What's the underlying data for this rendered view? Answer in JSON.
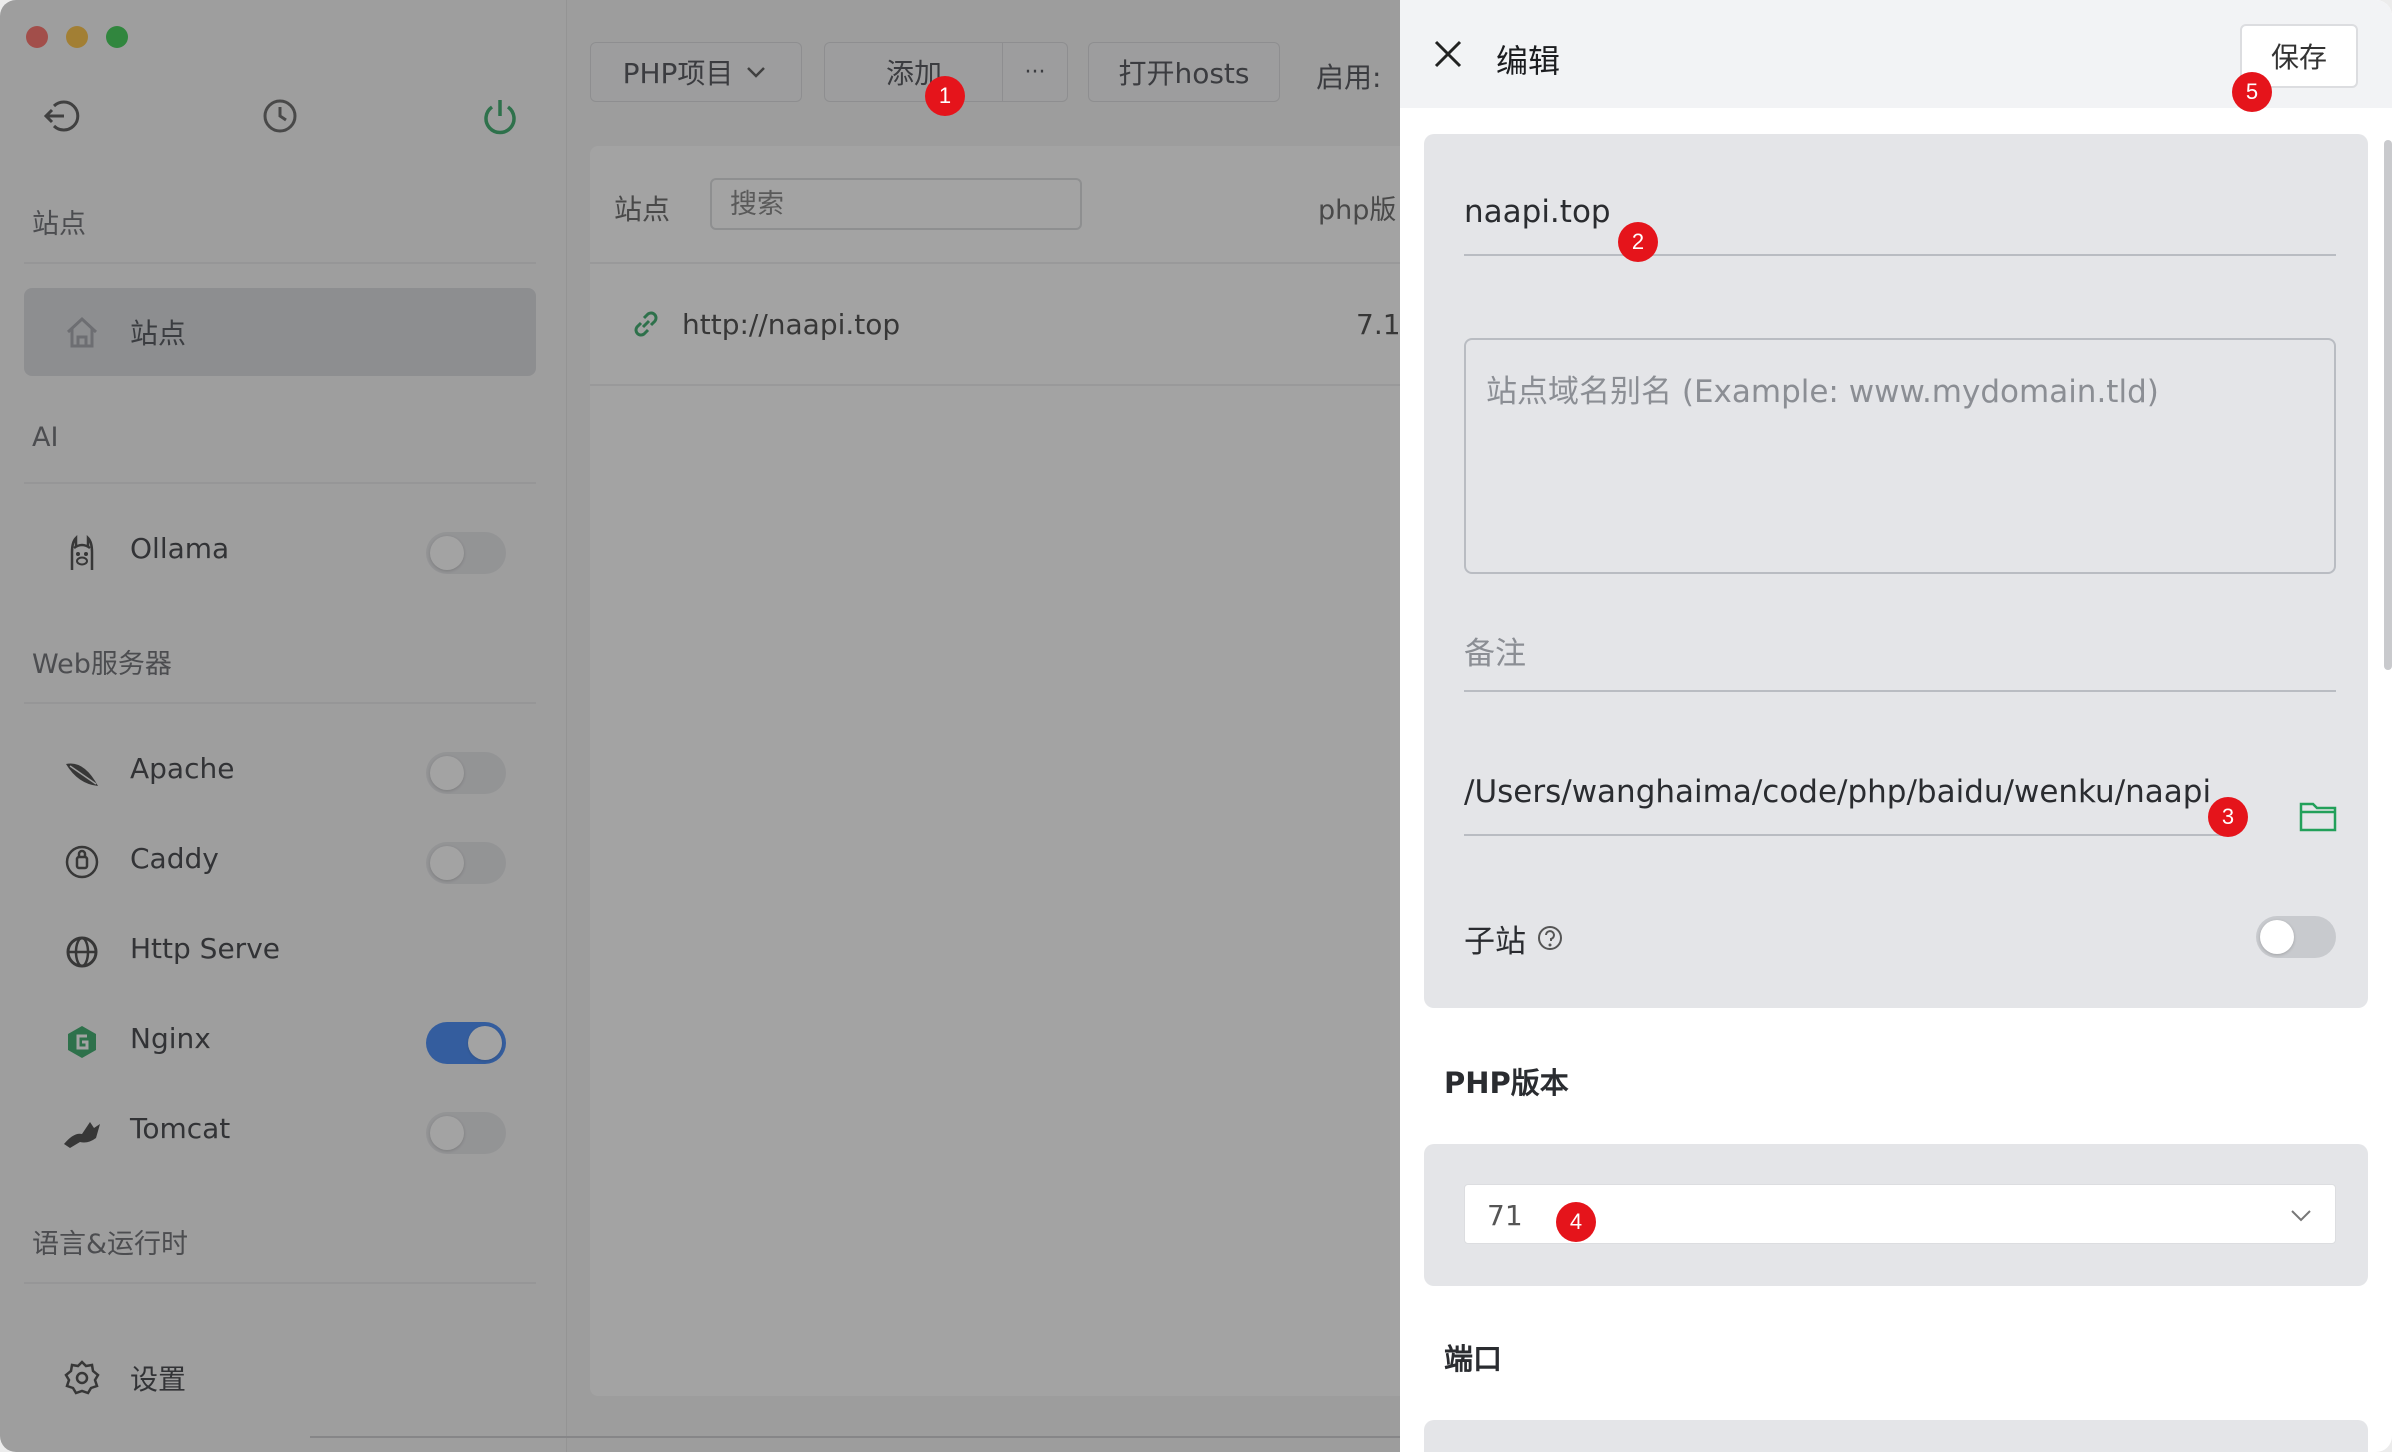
{
  "sidebar": {
    "sections": [
      {
        "label": "站点"
      },
      {
        "label": "AI"
      },
      {
        "label": "Web服务器"
      },
      {
        "label": "语言&运行时"
      }
    ],
    "active_item": {
      "label": "站点",
      "icon": "home-icon"
    },
    "items": [
      {
        "label": "Ollama",
        "icon": "llama-icon",
        "enabled": false
      },
      {
        "label": "Apache",
        "icon": "feather-icon",
        "enabled": false
      },
      {
        "label": "Caddy",
        "icon": "caddy-icon",
        "enabled": false
      },
      {
        "label": "Http Serve",
        "icon": "globe-icon"
      },
      {
        "label": "Nginx",
        "icon": "nginx-icon",
        "enabled": true
      },
      {
        "label": "Tomcat",
        "icon": "tomcat-icon",
        "enabled": false
      }
    ],
    "settings_label": "设置"
  },
  "toolbar": {
    "project_type": "PHP项目",
    "add_label": "添加",
    "more_label": "···",
    "open_hosts_label": "打开hosts",
    "enabled_label": "启用:"
  },
  "list": {
    "site_header": "站点",
    "search_placeholder": "搜索",
    "php_header": "php版",
    "rows": [
      {
        "url": "http://naapi.top",
        "php": "7.1"
      }
    ]
  },
  "drawer": {
    "title": "编辑",
    "save_label": "保存",
    "domain_value": "naapi.top",
    "alias_placeholder": "站点域名别名 (Example: www.mydomain.tld)",
    "note_placeholder": "备注",
    "root_path": "/Users/wanghaima/code/php/baidu/wenku/naapi",
    "subsite_label": "子站",
    "subsite_enabled": false,
    "php_version_label": "PHP版本",
    "php_version_value": "71",
    "port_label": "端口"
  },
  "badges": [
    "1",
    "2",
    "3",
    "4",
    "5"
  ],
  "colors": {
    "accent": "#2f7cf6",
    "badge": "#e5141b",
    "green": "#22a05a"
  }
}
